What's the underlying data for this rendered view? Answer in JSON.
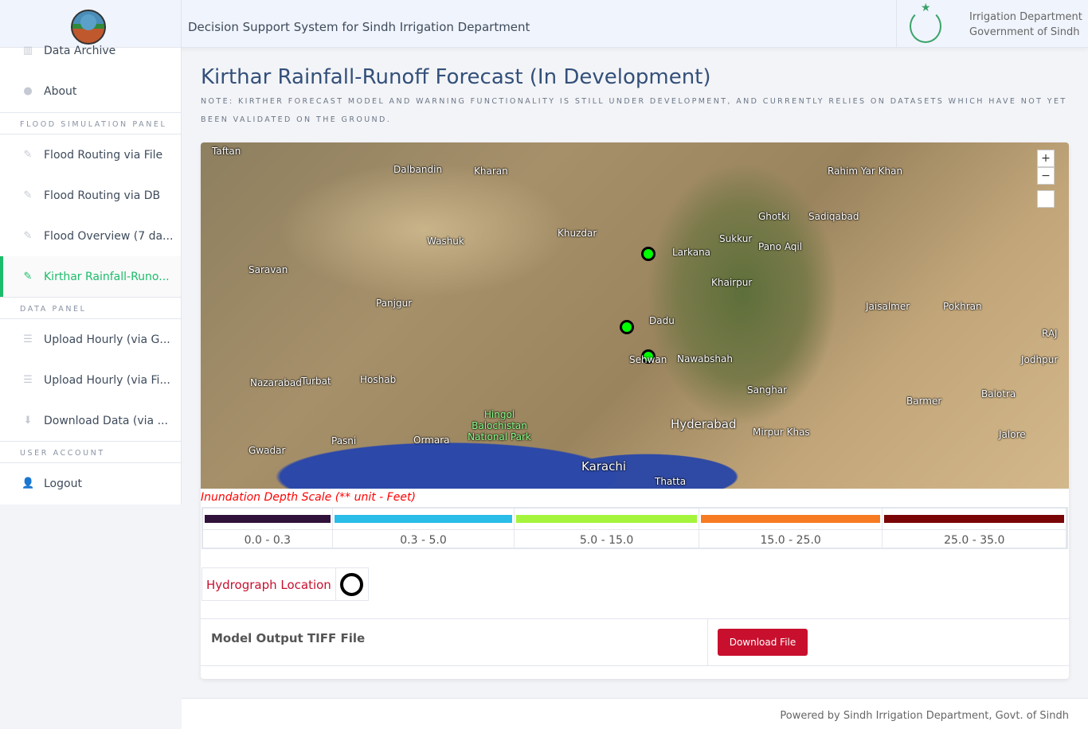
{
  "header": {
    "title": "Decision Support System for Sindh Irrigation Department",
    "dept_line1": "Irrigation Department",
    "dept_line2": "Government of Sindh"
  },
  "sidebar": {
    "items_top": [
      {
        "label": "Data Archive",
        "icon": "columns-icon"
      },
      {
        "label": "About",
        "icon": "info-icon"
      }
    ],
    "section_flood": "FLOOD SIMULATION PANEL",
    "flood_items": [
      {
        "label": "Flood Routing via File",
        "icon": "pencil-icon"
      },
      {
        "label": "Flood Routing via DB",
        "icon": "pencil-icon"
      },
      {
        "label": "Flood Overview (7 da...",
        "icon": "pencil-icon"
      },
      {
        "label": "Kirthar Rainfall-Runo...",
        "icon": "pencil-icon",
        "active": true
      }
    ],
    "section_data": "DATA PANEL",
    "data_items": [
      {
        "label": "Upload Hourly (via G...",
        "icon": "list-icon"
      },
      {
        "label": "Upload Hourly (via Fi...",
        "icon": "list-icon"
      },
      {
        "label": "Download Data (via ...",
        "icon": "download-icon"
      }
    ],
    "section_user": "USER ACCOUNT",
    "user_items": [
      {
        "label": "Logout",
        "icon": "user-icon"
      }
    ]
  },
  "main": {
    "title": "Kirthar Rainfall-Runoff Forecast (In Development)",
    "note": "NOTE: KIRTHER FORECAST MODEL AND WARNING FUNCTIONALITY IS STILL UNDER DEVELOPMENT, AND CURRENTLY RELIES ON DATASETS WHICH HAVE NOT YET BEEN VALIDATED ON THE GROUND.",
    "map": {
      "zoom_in": "+",
      "zoom_out": "−",
      "labels": [
        "Taftan",
        "Dalbandin",
        "Kharan",
        "Washuk",
        "Khuzdar",
        "Larkana",
        "Sukkur",
        "Ghotki",
        "Rahim Yar Khan",
        "Sadiqabad",
        "Pano Aqil",
        "Khairpur",
        "Dadu",
        "Sehwan",
        "Nawabshah",
        "Jaisalmer",
        "Pokhran",
        "Saravan",
        "Panjgur",
        "Turbat",
        "Hoshab",
        "Nazarabad",
        "Gwadar",
        "Pasni",
        "Ormara",
        "Hingol Balochistan National Park",
        "Karachi",
        "Thatta",
        "Hyderabad",
        "Mirpur Khas",
        "Sanghar",
        "Barmer",
        "Balotra",
        "Jodhpur",
        "Jalore",
        "RAJ"
      ]
    },
    "scale": {
      "title": "Inundation Depth Scale (** unit - Feet)",
      "bins": [
        {
          "range": "0.0 - 0.3",
          "color": "#31123a"
        },
        {
          "range": "0.3 - 5.0",
          "color": "#29bde8"
        },
        {
          "range": "5.0 - 15.0",
          "color": "#a4f43c"
        },
        {
          "range": "15.0 - 25.0",
          "color": "#f77b22"
        },
        {
          "range": "25.0 - 35.0",
          "color": "#7a0506"
        }
      ]
    },
    "hydrograph_label": "Hydrograph Location",
    "tiff_label": "Model Output TIFF File",
    "download_button": "Download File"
  },
  "footer": "Powered by Sindh Irrigation Department, Govt. of Sindh"
}
